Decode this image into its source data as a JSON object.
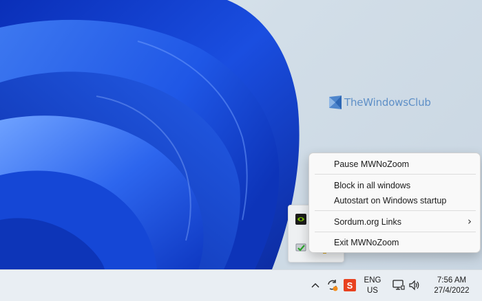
{
  "watermark": {
    "text": "TheWindowsClub"
  },
  "context_menu": {
    "items": [
      {
        "label": "Pause MWNoZoom"
      },
      {
        "label": "Block in all windows"
      },
      {
        "label": "Autostart on Windows startup"
      },
      {
        "label": "Sordum.org Links",
        "submenu_arrow": "›"
      },
      {
        "label": "Exit MWNoZoom"
      }
    ]
  },
  "tray_flyout": {
    "icons": [
      "nvidia-icon",
      "app-check-icon"
    ]
  },
  "taskbar": {
    "tray_icons": [
      "chevron-up-icon",
      "sync-icon",
      "app-s-icon",
      "network-icon",
      "volume-icon"
    ],
    "language": {
      "line1": "ENG",
      "line2": "US"
    },
    "clock": {
      "time": "7:56 AM",
      "date": "27/4/2022"
    }
  },
  "colors": {
    "accent": "#0067c0",
    "wallpaper_blue": "#1f4fd6",
    "taskbar": "#e9eef3",
    "watermark": "#5e8fc7"
  }
}
